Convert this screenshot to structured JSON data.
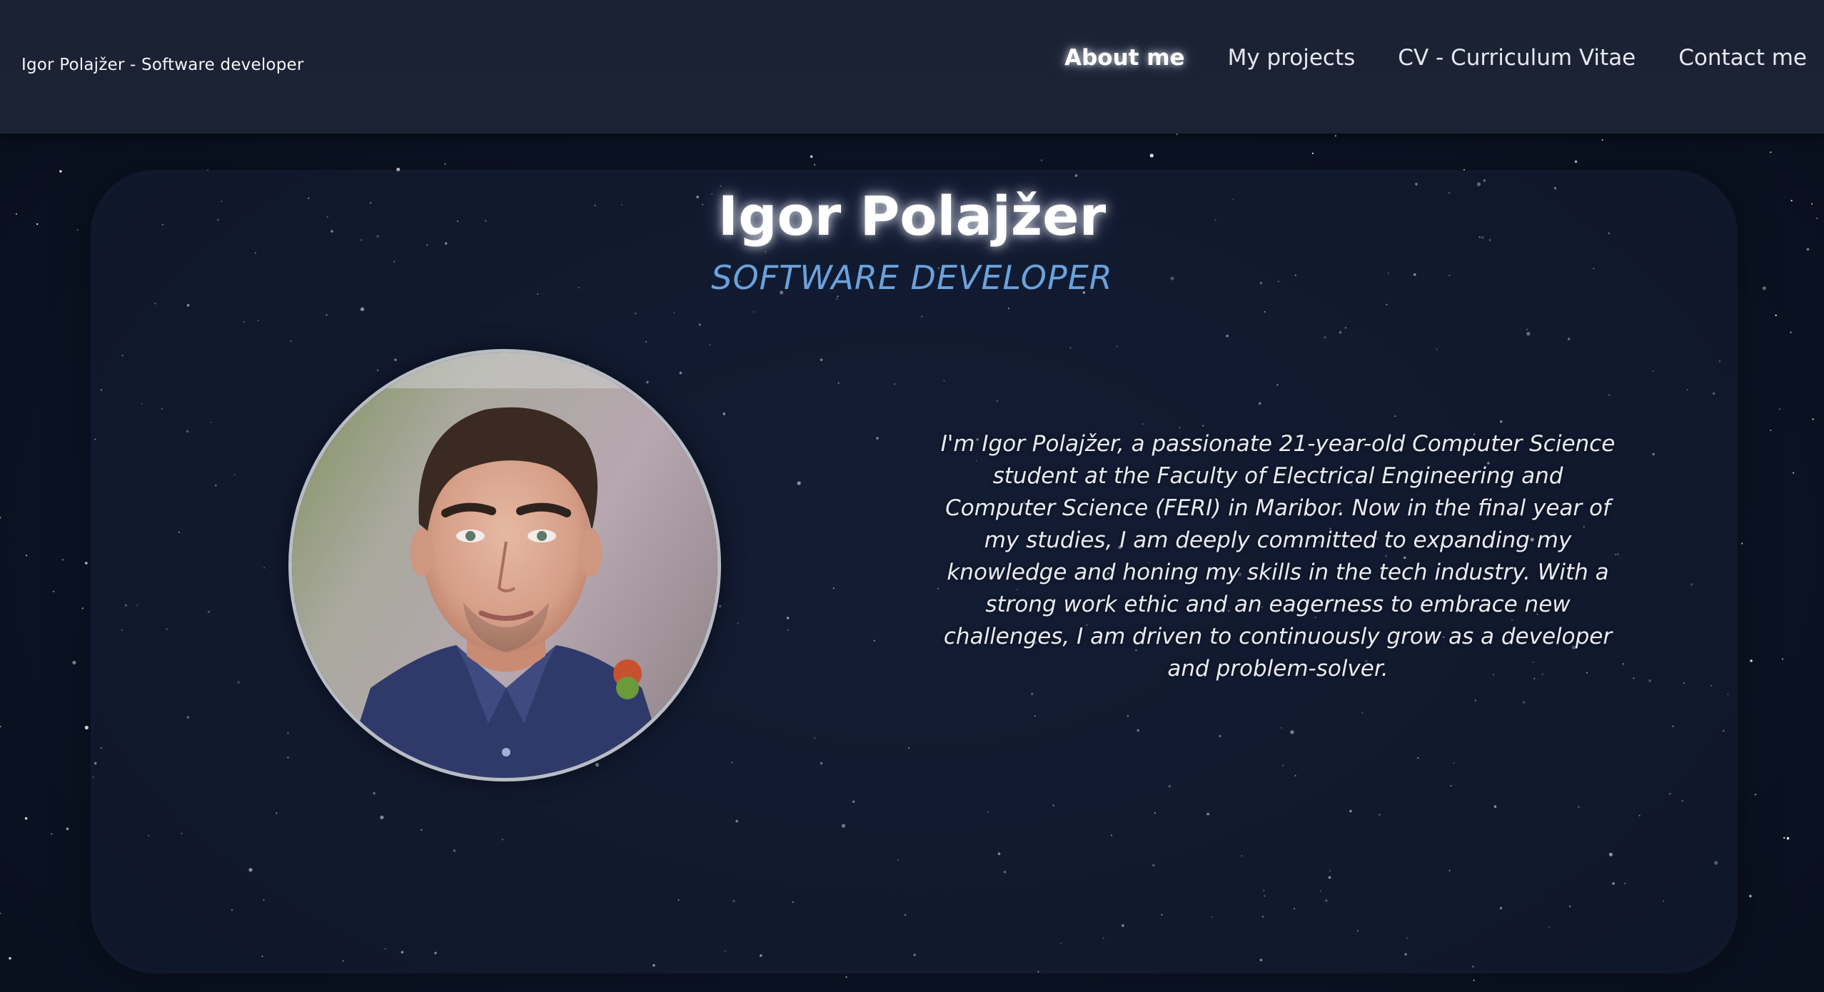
{
  "header": {
    "brand": "Igor Polajžer - Software developer",
    "nav": [
      {
        "label": "About me",
        "active": true
      },
      {
        "label": "My projects",
        "active": false
      },
      {
        "label": "CV - Curriculum Vitae",
        "active": false
      },
      {
        "label": "Contact me",
        "active": false
      }
    ]
  },
  "hero": {
    "name": "Igor Polajžer",
    "role": "SOFTWARE DEVELOPER",
    "bio": "I'm Igor Polajžer, a passionate 21-year-old Computer Science student at the Faculty of Electrical Engineering and Computer Science (FERI) in Maribor. Now in the final year of my studies, I am deeply committed to expanding my knowledge and honing my skills in the tech industry. With a strong work ethic and an eagerness to embrace new challenges, I am driven to continuously grow as a developer and problem-solver."
  },
  "colors": {
    "background": "#0b1220",
    "header": "#1c2334",
    "accent": "#6aa2dc",
    "text": "#ffffff"
  }
}
